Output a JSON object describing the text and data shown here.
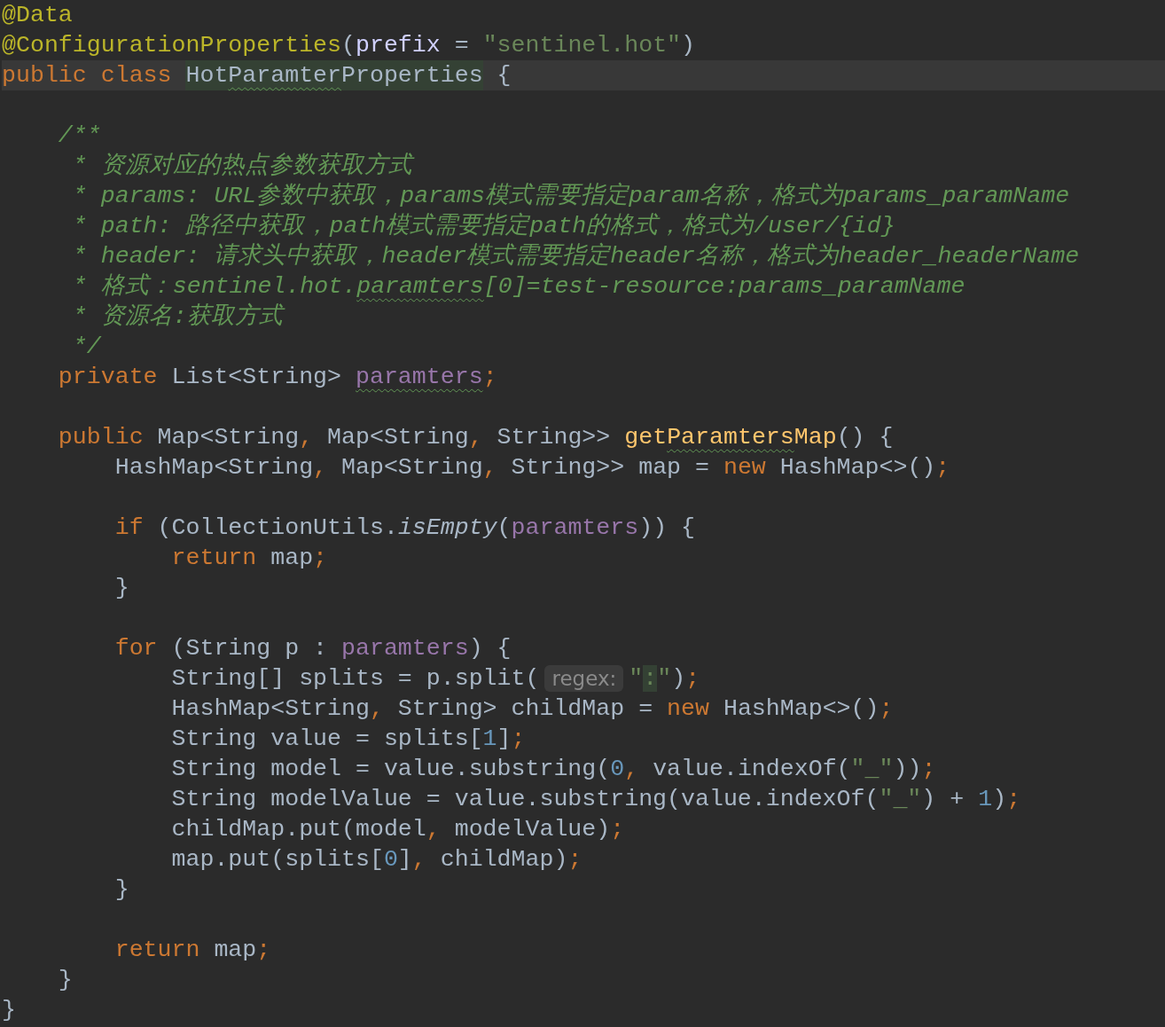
{
  "editor": {
    "lines": [
      {
        "current": false,
        "tokens": [
          {
            "text": "@Data",
            "kind": "annotation"
          }
        ]
      },
      {
        "current": false,
        "tokens": [
          {
            "text": "@ConfigurationProperties",
            "kind": "annotation"
          },
          {
            "text": "(",
            "kind": "plain"
          },
          {
            "text": "prefix",
            "kind": "attr"
          },
          {
            "text": " = ",
            "kind": "plain"
          },
          {
            "text": "\"sentinel.hot\"",
            "kind": "string"
          },
          {
            "text": ")",
            "kind": "plain"
          }
        ]
      },
      {
        "current": true,
        "tokens": [
          {
            "text": "public class ",
            "kind": "keyword"
          },
          {
            "text": "Hot",
            "kind": "plain",
            "highlighted": true
          },
          {
            "text": "Paramter",
            "kind": "plain",
            "highlighted": true,
            "typo": true
          },
          {
            "text": "Properties",
            "kind": "plain",
            "highlighted": true
          },
          {
            "text": " {",
            "kind": "plain"
          }
        ]
      },
      {
        "current": false
      },
      {
        "current": false,
        "tokens": [
          {
            "text": "    /**",
            "kind": "doc"
          }
        ]
      },
      {
        "current": false,
        "tokens": [
          {
            "text": "     * 资源对应的热点参数获取方式",
            "kind": "doc"
          }
        ]
      },
      {
        "current": false,
        "tokens": [
          {
            "text": "     * params: URL参数中获取，params模式需要指定param名称，格式为params_paramName",
            "kind": "doc"
          }
        ]
      },
      {
        "current": false,
        "tokens": [
          {
            "text": "     * path: 路径中获取，path模式需要指定path的格式，格式为/user/{id}",
            "kind": "doc"
          }
        ]
      },
      {
        "current": false,
        "tokens": [
          {
            "text": "     * header: 请求头中获取，header模式需要指定header名称，格式为header_headerName",
            "kind": "doc"
          }
        ]
      },
      {
        "current": false,
        "tokens": [
          {
            "text": "     * 格式：sentinel.hot.",
            "kind": "doc"
          },
          {
            "text": "paramters",
            "kind": "doc",
            "typo": true
          },
          {
            "text": "[0]=test-resource:params_paramName",
            "kind": "doc"
          }
        ]
      },
      {
        "current": false,
        "tokens": [
          {
            "text": "     * 资源名:获取方式",
            "kind": "doc"
          }
        ]
      },
      {
        "current": false,
        "tokens": [
          {
            "text": "     */",
            "kind": "doc"
          }
        ]
      },
      {
        "current": false,
        "tokens": [
          {
            "text": "    private ",
            "kind": "keyword"
          },
          {
            "text": "List<String> ",
            "kind": "plain"
          },
          {
            "text": "paramters",
            "kind": "field",
            "typo": true
          },
          {
            "text": ";",
            "kind": "punct"
          }
        ]
      },
      {
        "current": false
      },
      {
        "current": false,
        "tokens": [
          {
            "text": "    public ",
            "kind": "keyword"
          },
          {
            "text": "Map<String",
            "kind": "plain"
          },
          {
            "text": ", ",
            "kind": "punct"
          },
          {
            "text": "Map<String",
            "kind": "plain"
          },
          {
            "text": ", ",
            "kind": "punct"
          },
          {
            "text": "String>> ",
            "kind": "plain"
          },
          {
            "text": "get",
            "kind": "method"
          },
          {
            "text": "Paramters",
            "kind": "method",
            "typo": true
          },
          {
            "text": "Map",
            "kind": "method"
          },
          {
            "text": "() {",
            "kind": "plain"
          }
        ]
      },
      {
        "current": false,
        "tokens": [
          {
            "text": "        HashMap<String",
            "kind": "plain"
          },
          {
            "text": ", ",
            "kind": "punct"
          },
          {
            "text": "Map<String",
            "kind": "plain"
          },
          {
            "text": ", ",
            "kind": "punct"
          },
          {
            "text": "String>> map = ",
            "kind": "plain"
          },
          {
            "text": "new ",
            "kind": "keyword"
          },
          {
            "text": "HashMap<>()",
            "kind": "plain"
          },
          {
            "text": ";",
            "kind": "punct"
          }
        ]
      },
      {
        "current": false
      },
      {
        "current": false,
        "tokens": [
          {
            "text": "        if ",
            "kind": "keyword"
          },
          {
            "text": "(CollectionUtils.",
            "kind": "plain"
          },
          {
            "text": "isEmpty",
            "kind": "static"
          },
          {
            "text": "(",
            "kind": "plain"
          },
          {
            "text": "paramters",
            "kind": "field"
          },
          {
            "text": ")) {",
            "kind": "plain"
          }
        ]
      },
      {
        "current": false,
        "tokens": [
          {
            "text": "            return ",
            "kind": "keyword"
          },
          {
            "text": "map",
            "kind": "plain"
          },
          {
            "text": ";",
            "kind": "punct"
          }
        ]
      },
      {
        "current": false,
        "tokens": [
          {
            "text": "        }",
            "kind": "plain"
          }
        ]
      },
      {
        "current": false
      },
      {
        "current": false,
        "tokens": [
          {
            "text": "        for ",
            "kind": "keyword"
          },
          {
            "text": "(String p : ",
            "kind": "plain"
          },
          {
            "text": "paramters",
            "kind": "field"
          },
          {
            "text": ") {",
            "kind": "plain"
          }
        ]
      },
      {
        "current": false,
        "tokens": [
          {
            "text": "            String[] splits = p.split(",
            "kind": "plain"
          },
          {
            "text": "regex:",
            "kind": "hint"
          },
          {
            "text": "\"",
            "kind": "string"
          },
          {
            "text": ":",
            "kind": "string",
            "highlighted": true
          },
          {
            "text": "\"",
            "kind": "string"
          },
          {
            "text": ")",
            "kind": "plain"
          },
          {
            "text": ";",
            "kind": "punct"
          }
        ]
      },
      {
        "current": false,
        "tokens": [
          {
            "text": "            HashMap<String",
            "kind": "plain"
          },
          {
            "text": ", ",
            "kind": "punct"
          },
          {
            "text": "String> childMap = ",
            "kind": "plain"
          },
          {
            "text": "new ",
            "kind": "keyword"
          },
          {
            "text": "HashMap<>()",
            "kind": "plain"
          },
          {
            "text": ";",
            "kind": "punct"
          }
        ]
      },
      {
        "current": false,
        "tokens": [
          {
            "text": "            String value = splits[",
            "kind": "plain"
          },
          {
            "text": "1",
            "kind": "number"
          },
          {
            "text": "]",
            "kind": "plain"
          },
          {
            "text": ";",
            "kind": "punct"
          }
        ]
      },
      {
        "current": false,
        "tokens": [
          {
            "text": "            String model = value.substring(",
            "kind": "plain"
          },
          {
            "text": "0",
            "kind": "number"
          },
          {
            "text": ", ",
            "kind": "punct"
          },
          {
            "text": "value.indexOf(",
            "kind": "plain"
          },
          {
            "text": "\"_\"",
            "kind": "string"
          },
          {
            "text": "))",
            "kind": "plain"
          },
          {
            "text": ";",
            "kind": "punct"
          }
        ]
      },
      {
        "current": false,
        "tokens": [
          {
            "text": "            String modelValue = value.substring(value.indexOf(",
            "kind": "plain"
          },
          {
            "text": "\"_\"",
            "kind": "string"
          },
          {
            "text": ") + ",
            "kind": "plain"
          },
          {
            "text": "1",
            "kind": "number"
          },
          {
            "text": ")",
            "kind": "plain"
          },
          {
            "text": ";",
            "kind": "punct"
          }
        ]
      },
      {
        "current": false,
        "tokens": [
          {
            "text": "            childMap.put(model",
            "kind": "plain"
          },
          {
            "text": ", ",
            "kind": "punct"
          },
          {
            "text": "modelValue)",
            "kind": "plain"
          },
          {
            "text": ";",
            "kind": "punct"
          }
        ]
      },
      {
        "current": false,
        "tokens": [
          {
            "text": "            map.put(splits[",
            "kind": "plain"
          },
          {
            "text": "0",
            "kind": "number"
          },
          {
            "text": "]",
            "kind": "plain"
          },
          {
            "text": ", ",
            "kind": "punct"
          },
          {
            "text": "childMap)",
            "kind": "plain"
          },
          {
            "text": ";",
            "kind": "punct"
          }
        ]
      },
      {
        "current": false,
        "tokens": [
          {
            "text": "        }",
            "kind": "plain"
          }
        ]
      },
      {
        "current": false
      },
      {
        "current": false,
        "tokens": [
          {
            "text": "        return ",
            "kind": "keyword"
          },
          {
            "text": "map",
            "kind": "plain"
          },
          {
            "text": ";",
            "kind": "punct"
          }
        ]
      },
      {
        "current": false,
        "tokens": [
          {
            "text": "    }",
            "kind": "plain"
          }
        ]
      },
      {
        "current": false,
        "tokens": [
          {
            "text": "}",
            "kind": "plain"
          }
        ]
      }
    ]
  }
}
